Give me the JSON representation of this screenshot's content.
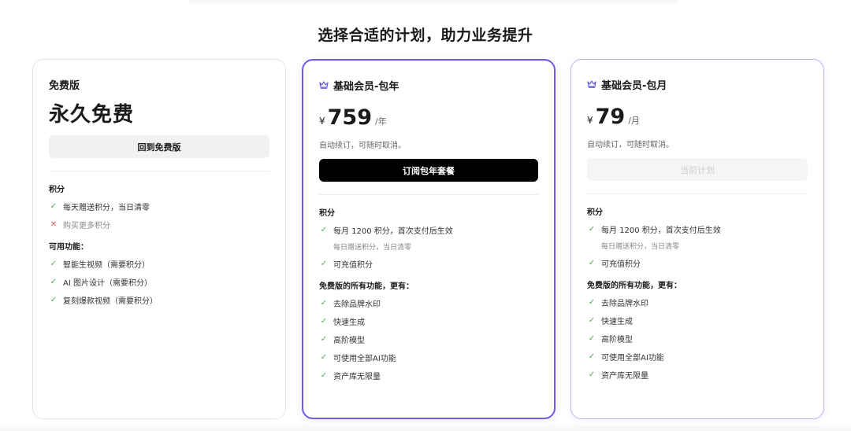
{
  "headline": "选择合适的计划，助力业务提升",
  "free": {
    "name": "免费版",
    "price": "永久免费",
    "button": "回到免费版",
    "credits_title": "积分",
    "credits": [
      {
        "text": "每天赠送积分，当日清零",
        "mark": "✓",
        "type": "check"
      },
      {
        "text": "购买更多积分",
        "mark": "✕",
        "type": "cross"
      }
    ],
    "features_title": "可用功能：",
    "features": [
      {
        "text": "智能生视频（需要积分）",
        "mark": "✓"
      },
      {
        "text": "AI 图片设计（需要积分）",
        "mark": "✓"
      },
      {
        "text": "复刻爆款视频（需要积分）",
        "mark": "✓"
      }
    ]
  },
  "year": {
    "name": "基础会员-包年",
    "crown_icon": "crown-icon",
    "currency": "¥",
    "amount": "759",
    "period": "/年",
    "desc": "自动续订，可随时取消。",
    "button": "订阅包年套餐",
    "credits_title": "积分",
    "credit_main": "每月 1200 积分，首次支付后生效",
    "credit_note": "每日赠送积分，当日清零",
    "credit_recharge": "可充值积分",
    "features_title": "免费版的所有功能，更有：",
    "features": [
      "去除品牌水印",
      "快速生成",
      "高阶模型",
      "可使用全部AI功能",
      "资产库无限量"
    ],
    "check_mark": "✓"
  },
  "month": {
    "name": "基础会员-包月",
    "crown_icon": "crown-icon",
    "currency": "¥",
    "amount": "79",
    "period": "/月",
    "desc": "自动续订，可随时取消。",
    "button": "当前计划",
    "credits_title": "积分",
    "credit_main": "每月 1200 积分，首次支付后生效",
    "credit_note": "每日赠送积分，当日清零",
    "credit_recharge": "可充值积分",
    "features_title": "免费版的所有功能，更有：",
    "features": [
      "去除品牌水印",
      "快速生成",
      "高阶模型",
      "可使用全部AI功能",
      "资产库无限量"
    ],
    "check_mark": "✓"
  },
  "colors": {
    "accent": "#6b5ce7",
    "check": "#4caf50",
    "cross": "#e25555",
    "primary_button": "#000000"
  }
}
